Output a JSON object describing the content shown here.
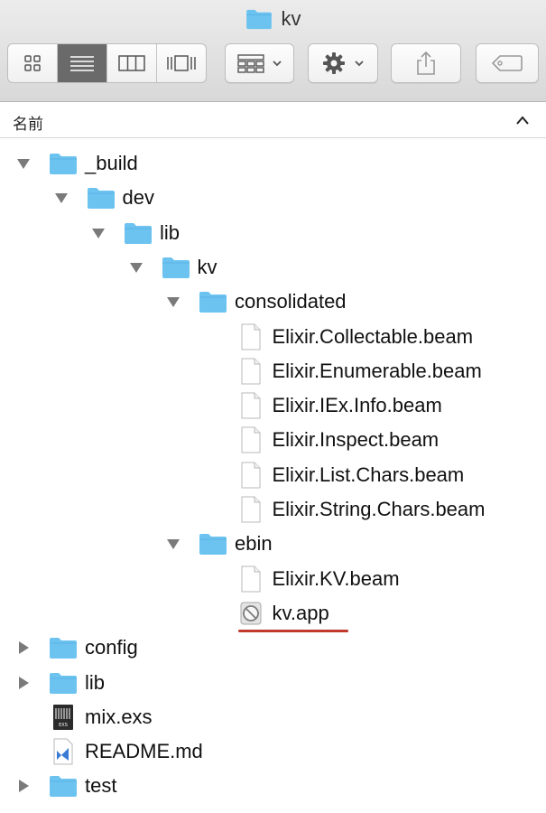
{
  "window": {
    "title": "kv"
  },
  "toolbar": {
    "view_modes": [
      "icon-view",
      "list-view",
      "column-view",
      "cover-flow-view"
    ],
    "active_view": "list-view",
    "group_button": "arrange",
    "action_button": "action",
    "share_button": "share",
    "tag_button": "tags"
  },
  "header": {
    "column_label": "名前",
    "sort": "ascending"
  },
  "files": [
    {
      "name": "_build",
      "kind": "folder",
      "level": 0,
      "expanded": true
    },
    {
      "name": "dev",
      "kind": "folder",
      "level": 1,
      "expanded": true
    },
    {
      "name": "lib",
      "kind": "folder",
      "level": 2,
      "expanded": true
    },
    {
      "name": "kv",
      "kind": "folder",
      "level": 3,
      "expanded": true
    },
    {
      "name": "consolidated",
      "kind": "folder",
      "level": 4,
      "expanded": true
    },
    {
      "name": "Elixir.Collectable.beam",
      "kind": "file",
      "level": 5
    },
    {
      "name": "Elixir.Enumerable.beam",
      "kind": "file",
      "level": 5
    },
    {
      "name": "Elixir.IEx.Info.beam",
      "kind": "file",
      "level": 5
    },
    {
      "name": "Elixir.Inspect.beam",
      "kind": "file",
      "level": 5
    },
    {
      "name": "Elixir.List.Chars.beam",
      "kind": "file",
      "level": 5
    },
    {
      "name": "Elixir.String.Chars.beam",
      "kind": "file",
      "level": 5
    },
    {
      "name": "ebin",
      "kind": "folder",
      "level": 4,
      "expanded": true
    },
    {
      "name": "Elixir.KV.beam",
      "kind": "file",
      "level": 5
    },
    {
      "name": "kv.app",
      "kind": "app",
      "level": 5,
      "highlighted": true
    },
    {
      "name": "config",
      "kind": "folder",
      "level": 0,
      "expanded": false
    },
    {
      "name": "lib",
      "kind": "folder",
      "level": 0,
      "expanded": false
    },
    {
      "name": "mix.exs",
      "kind": "exs",
      "level": 0
    },
    {
      "name": "README.md",
      "kind": "md",
      "level": 0
    },
    {
      "name": "test",
      "kind": "folder",
      "level": 0,
      "expanded": false
    }
  ],
  "colors": {
    "folder": "#6cc3f0",
    "folder_tab": "#5ab3e6",
    "highlight_underline": "#c0392b",
    "active_segment": "#6a6a6a"
  },
  "icons": {
    "exs_label": "EXS"
  }
}
